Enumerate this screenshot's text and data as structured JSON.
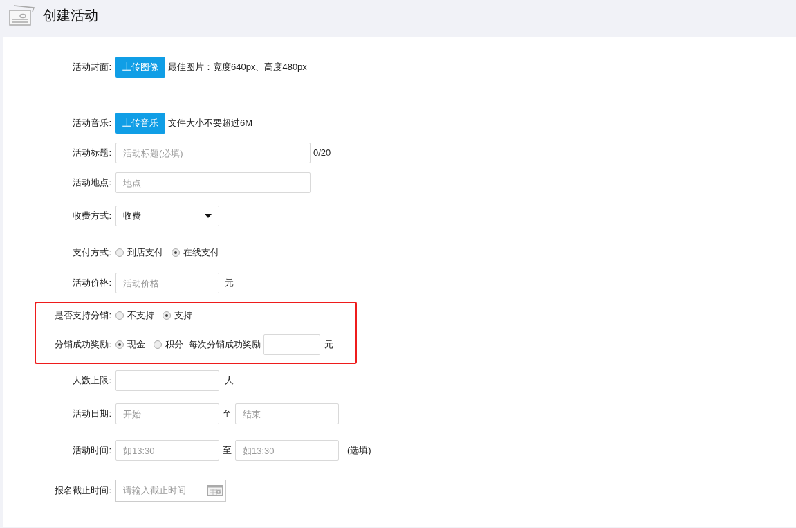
{
  "header": {
    "title": "创建活动"
  },
  "sections": [
    {
      "highlighted": false,
      "rows": [
        {
          "kind": "upload",
          "label": "活动封面:",
          "button": "上传图像",
          "note": "最佳图片：宽度640px、高度480px"
        },
        {
          "kind": "upload",
          "label": "活动音乐:",
          "button": "上传音乐",
          "note": "文件大小不要超过6M"
        },
        {
          "kind": "text_wide",
          "label": "活动标题:",
          "placeholder": "活动标题(必填)",
          "suffix": "0/20"
        },
        {
          "kind": "text_wide",
          "label": "活动地点:",
          "placeholder": "地点"
        },
        {
          "kind": "select",
          "label": "收费方式:",
          "value": "收费"
        },
        {
          "kind": "radio",
          "label": "支付方式:",
          "options": [
            {
              "label": "到店支付",
              "selected": false
            },
            {
              "label": "在线支付",
              "selected": true
            }
          ]
        },
        {
          "kind": "text",
          "label": "活动价格:",
          "placeholder": "活动价格",
          "suffix": "元"
        }
      ]
    },
    {
      "highlighted": true,
      "rows": [
        {
          "kind": "radio",
          "label": "是否支持分销:",
          "options": [
            {
              "label": "不支持",
              "selected": false
            },
            {
              "label": "支持",
              "selected": true
            }
          ]
        },
        {
          "kind": "radio",
          "label": "分销成功奖励:",
          "options": [
            {
              "label": "现金",
              "selected": true
            },
            {
              "label": "积分",
              "selected": false
            }
          ],
          "extra_label": "每次分销成功奖励",
          "suffix": "元"
        }
      ]
    },
    {
      "highlighted": false,
      "rows": [
        {
          "kind": "text",
          "label": "人数上限:",
          "suffix": "人"
        },
        {
          "kind": "range",
          "label": "活动日期:",
          "from_placeholder": "开始",
          "separator": "至",
          "to_placeholder": "结束"
        },
        {
          "kind": "range",
          "label": "活动时间:",
          "from_placeholder": "如13:30",
          "separator": "至",
          "to_placeholder": "如13:30",
          "suffix": "(选填)"
        },
        {
          "kind": "date",
          "label": "报名截止时间:",
          "placeholder": "请输入截止时间"
        }
      ]
    }
  ]
}
